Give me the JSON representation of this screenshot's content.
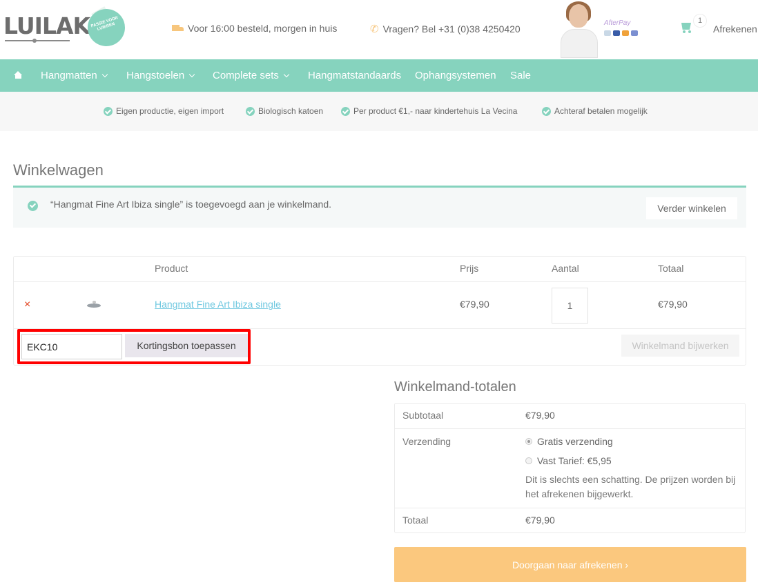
{
  "header": {
    "logo": "LUILAK",
    "badge_text": "PASSIE VOOR LUIEREN",
    "delivery_text": "Voor 16:00 besteld, morgen in huis",
    "phone_text": "Vragen? Bel +31 (0)38 4250420",
    "payment_brand": "AfterPay",
    "cart_count": "1",
    "checkout_link": "Afrekenen",
    "colors": {
      "accent": "#86d3be",
      "icon_orange": "#f7c67d"
    }
  },
  "nav": {
    "items": [
      {
        "label": "Hangmatten",
        "dropdown": true
      },
      {
        "label": "Hangstoelen",
        "dropdown": true
      },
      {
        "label": "Complete sets",
        "dropdown": true
      },
      {
        "label": "Hangmatstandaards",
        "dropdown": false
      },
      {
        "label": "Ophangsystemen",
        "dropdown": false
      },
      {
        "label": "Sale",
        "dropdown": false
      }
    ]
  },
  "usp": [
    "Eigen productie, eigen import",
    "Biologisch katoen",
    "Per product €1,- naar kindertehuis La Vecina",
    "Achteraf betalen mogelijk"
  ],
  "page": {
    "title": "Winkelwagen",
    "notice": "“Hangmat Fine Art Ibiza single” is toegevoegd aan je winkelmand.",
    "continue_button": "Verder winkelen"
  },
  "cart": {
    "headers": {
      "product": "Product",
      "price": "Prijs",
      "quantity": "Aantal",
      "total": "Totaal"
    },
    "items": [
      {
        "remove": "×",
        "name": "Hangmat Fine Art Ibiza single",
        "price": "€79,90",
        "quantity": "1",
        "total": "€79,90"
      }
    ],
    "coupon_value": "EKC10",
    "coupon_button": "Kortingsbon toepassen",
    "update_button": "Winkelmand bijwerken"
  },
  "totals": {
    "title": "Winkelmand-totalen",
    "subtotal_label": "Subtotaal",
    "subtotal_value": "€79,90",
    "shipping_label": "Verzending",
    "shipping_options": [
      {
        "label": "Gratis verzending",
        "selected": true
      },
      {
        "label": "Vast Tarief: €5,95",
        "selected": false
      }
    ],
    "shipping_note": "Dit is slechts een schatting. De prijzen worden bij het afrekenen bijgewerkt.",
    "total_label": "Totaal",
    "total_value": "€79,90",
    "proceed_button": "Doorgaan naar afrekenen ›",
    "proceed_color": "#fbc87e"
  }
}
